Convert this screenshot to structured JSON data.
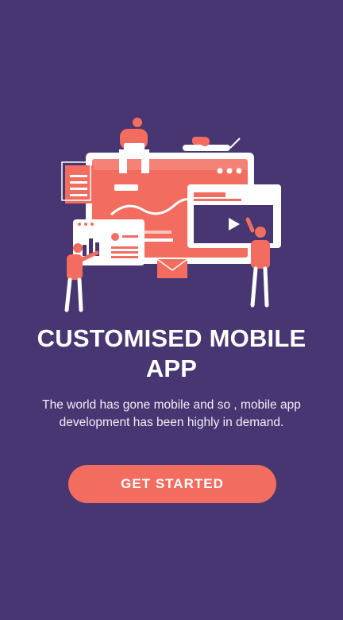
{
  "theme": {
    "background": "#473672",
    "accent": "#f26d5f",
    "text": "#ffffff"
  },
  "hero": {
    "illustration": "mobile-app-development-illustration"
  },
  "onboarding": {
    "title": "CUSTOMISED MOBILE APP",
    "description": "The world has gone mobile and so , mobile app development has been highly in demand.",
    "cta_label": "GET STARTED"
  }
}
